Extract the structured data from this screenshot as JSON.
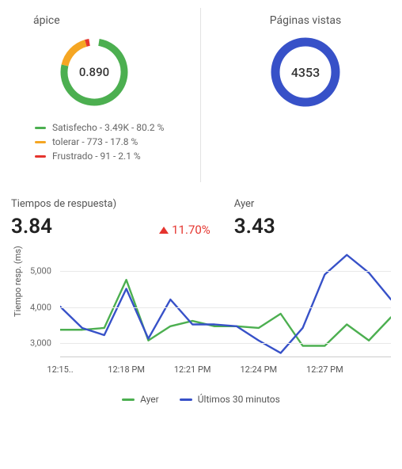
{
  "colors": {
    "green": "#4caf50",
    "orange": "#f5a623",
    "red": "#e5342e",
    "blue": "#3751c8",
    "grid": "#e8e8e8"
  },
  "apex": {
    "title": "ápice",
    "score": "0.890",
    "legend": [
      {
        "key": "satisfied",
        "color": "#4caf50",
        "text": "Satisfecho - 3.49K - 80.2 %"
      },
      {
        "key": "tolerating",
        "color": "#f5a623",
        "text": "tolerar - 773 - 17.8 %"
      },
      {
        "key": "frustrated",
        "color": "#e5342e",
        "text": "Frustrado - 91 - 2.1 %"
      }
    ]
  },
  "pageviews": {
    "title": "Páginas vistas",
    "value": "4353"
  },
  "response_times": {
    "left_label": "Tiempos de respuesta)",
    "left_value": "3.84",
    "delta_text": "11.70%",
    "right_label": "Ayer",
    "right_value": "3.43",
    "y_axis_label": "Tiempo resp. (ms)"
  },
  "legend2": {
    "a": "Ayer",
    "b": "Últimos 30 minutos"
  },
  "chart_data": [
    {
      "type": "pie",
      "title": "ápice",
      "center_value": 0.89,
      "series": [
        {
          "name": "Satisfecho",
          "value": 3490,
          "percent": 80.2
        },
        {
          "name": "tolerar",
          "value": 773,
          "percent": 17.8
        },
        {
          "name": "Frustrado",
          "value": 91,
          "percent": 2.1
        }
      ]
    },
    {
      "type": "line",
      "title": "Tiempos de respuesta",
      "ylabel": "Tiempo resp. (ms)",
      "ylim": [
        2600,
        5600
      ],
      "yticks": [
        3000,
        4000,
        5000
      ],
      "x": [
        "12:15 PM",
        "12:16 PM",
        "12:17 PM",
        "12:18 PM",
        "12:19 PM",
        "12:20 PM",
        "12:21 PM",
        "12:22 PM",
        "12:23 PM",
        "12:24 PM",
        "12:25 PM",
        "12:26 PM",
        "12:27 PM",
        "12:28 PM",
        "12:29 PM"
      ],
      "xticks": [
        "12:15..",
        "12:18 PM",
        "12:21 PM",
        "12:24 PM",
        "12:27 PM"
      ],
      "series": [
        {
          "name": "Ayer",
          "color": "#4caf50",
          "values": [
            3350,
            3350,
            3400,
            4750,
            3050,
            3450,
            3600,
            3450,
            3450,
            3400,
            3800,
            2900,
            2900,
            3500,
            3050
          ]
        },
        {
          "name": "Últimos 30 minutos",
          "color": "#3751c8",
          "values": [
            4000,
            3400,
            3200,
            4500,
            3100,
            4200,
            3500,
            3500,
            3450,
            3050,
            2700,
            3400,
            4900,
            5450,
            4950
          ]
        }
      ],
      "series_last_point": {
        "name": "Últimos 30 minutos",
        "x_next": "12:30 PM",
        "value": 4200
      }
    }
  ]
}
